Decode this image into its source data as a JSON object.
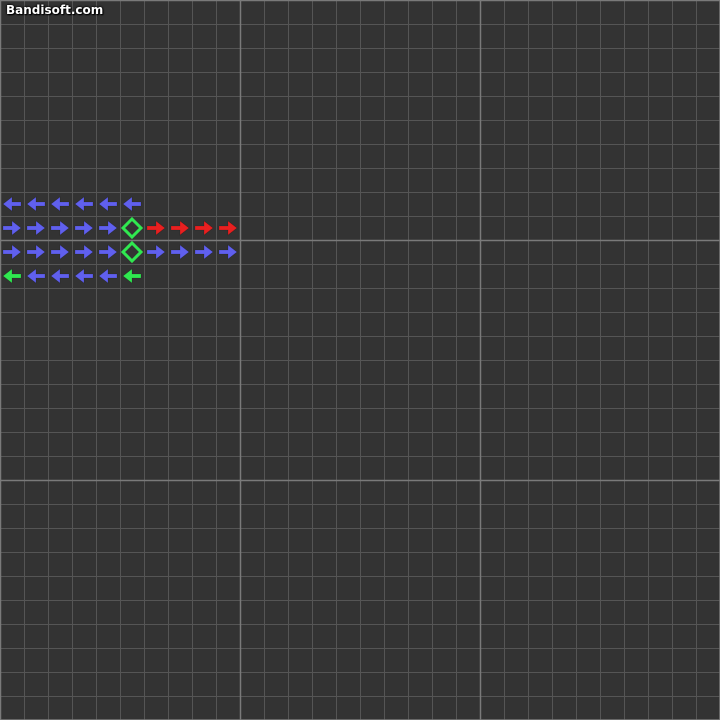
{
  "watermark": {
    "text": "Bandisoft.com"
  },
  "grid": {
    "columns": 30,
    "rows": 30,
    "major_every": 10,
    "background_color": "#333333",
    "minor_line_color": "#555555",
    "major_line_color": "#7a7a7a"
  },
  "colors": {
    "blue": "#6060ee",
    "red": "#e82020",
    "green": "#30e850"
  },
  "tiles": [
    {
      "row": 8,
      "col": 0,
      "kind": "arrow-left",
      "color": "blue"
    },
    {
      "row": 8,
      "col": 1,
      "kind": "arrow-left",
      "color": "blue"
    },
    {
      "row": 8,
      "col": 2,
      "kind": "arrow-left",
      "color": "blue"
    },
    {
      "row": 8,
      "col": 3,
      "kind": "arrow-left",
      "color": "blue"
    },
    {
      "row": 8,
      "col": 4,
      "kind": "arrow-left",
      "color": "blue"
    },
    {
      "row": 8,
      "col": 5,
      "kind": "arrow-left",
      "color": "blue"
    },
    {
      "row": 9,
      "col": 0,
      "kind": "arrow-right",
      "color": "blue"
    },
    {
      "row": 9,
      "col": 1,
      "kind": "arrow-right",
      "color": "blue"
    },
    {
      "row": 9,
      "col": 2,
      "kind": "arrow-right",
      "color": "blue"
    },
    {
      "row": 9,
      "col": 3,
      "kind": "arrow-right",
      "color": "blue"
    },
    {
      "row": 9,
      "col": 4,
      "kind": "arrow-right",
      "color": "blue"
    },
    {
      "row": 9,
      "col": 5,
      "kind": "diamond",
      "color": "green"
    },
    {
      "row": 9,
      "col": 6,
      "kind": "arrow-right",
      "color": "red"
    },
    {
      "row": 9,
      "col": 7,
      "kind": "arrow-right",
      "color": "red"
    },
    {
      "row": 9,
      "col": 8,
      "kind": "arrow-right",
      "color": "red"
    },
    {
      "row": 9,
      "col": 9,
      "kind": "arrow-right",
      "color": "red"
    },
    {
      "row": 10,
      "col": 0,
      "kind": "arrow-right",
      "color": "blue"
    },
    {
      "row": 10,
      "col": 1,
      "kind": "arrow-right",
      "color": "blue"
    },
    {
      "row": 10,
      "col": 2,
      "kind": "arrow-right",
      "color": "blue"
    },
    {
      "row": 10,
      "col": 3,
      "kind": "arrow-right",
      "color": "blue"
    },
    {
      "row": 10,
      "col": 4,
      "kind": "arrow-right",
      "color": "blue"
    },
    {
      "row": 10,
      "col": 5,
      "kind": "diamond",
      "color": "green"
    },
    {
      "row": 10,
      "col": 6,
      "kind": "arrow-right",
      "color": "blue"
    },
    {
      "row": 10,
      "col": 7,
      "kind": "arrow-right",
      "color": "blue"
    },
    {
      "row": 10,
      "col": 8,
      "kind": "arrow-right",
      "color": "blue"
    },
    {
      "row": 10,
      "col": 9,
      "kind": "arrow-right",
      "color": "blue"
    },
    {
      "row": 11,
      "col": 0,
      "kind": "arrow-left",
      "color": "green"
    },
    {
      "row": 11,
      "col": 1,
      "kind": "arrow-left",
      "color": "blue"
    },
    {
      "row": 11,
      "col": 2,
      "kind": "arrow-left",
      "color": "blue"
    },
    {
      "row": 11,
      "col": 3,
      "kind": "arrow-left",
      "color": "blue"
    },
    {
      "row": 11,
      "col": 4,
      "kind": "arrow-left",
      "color": "blue"
    },
    {
      "row": 11,
      "col": 5,
      "kind": "arrow-left",
      "color": "green"
    }
  ]
}
